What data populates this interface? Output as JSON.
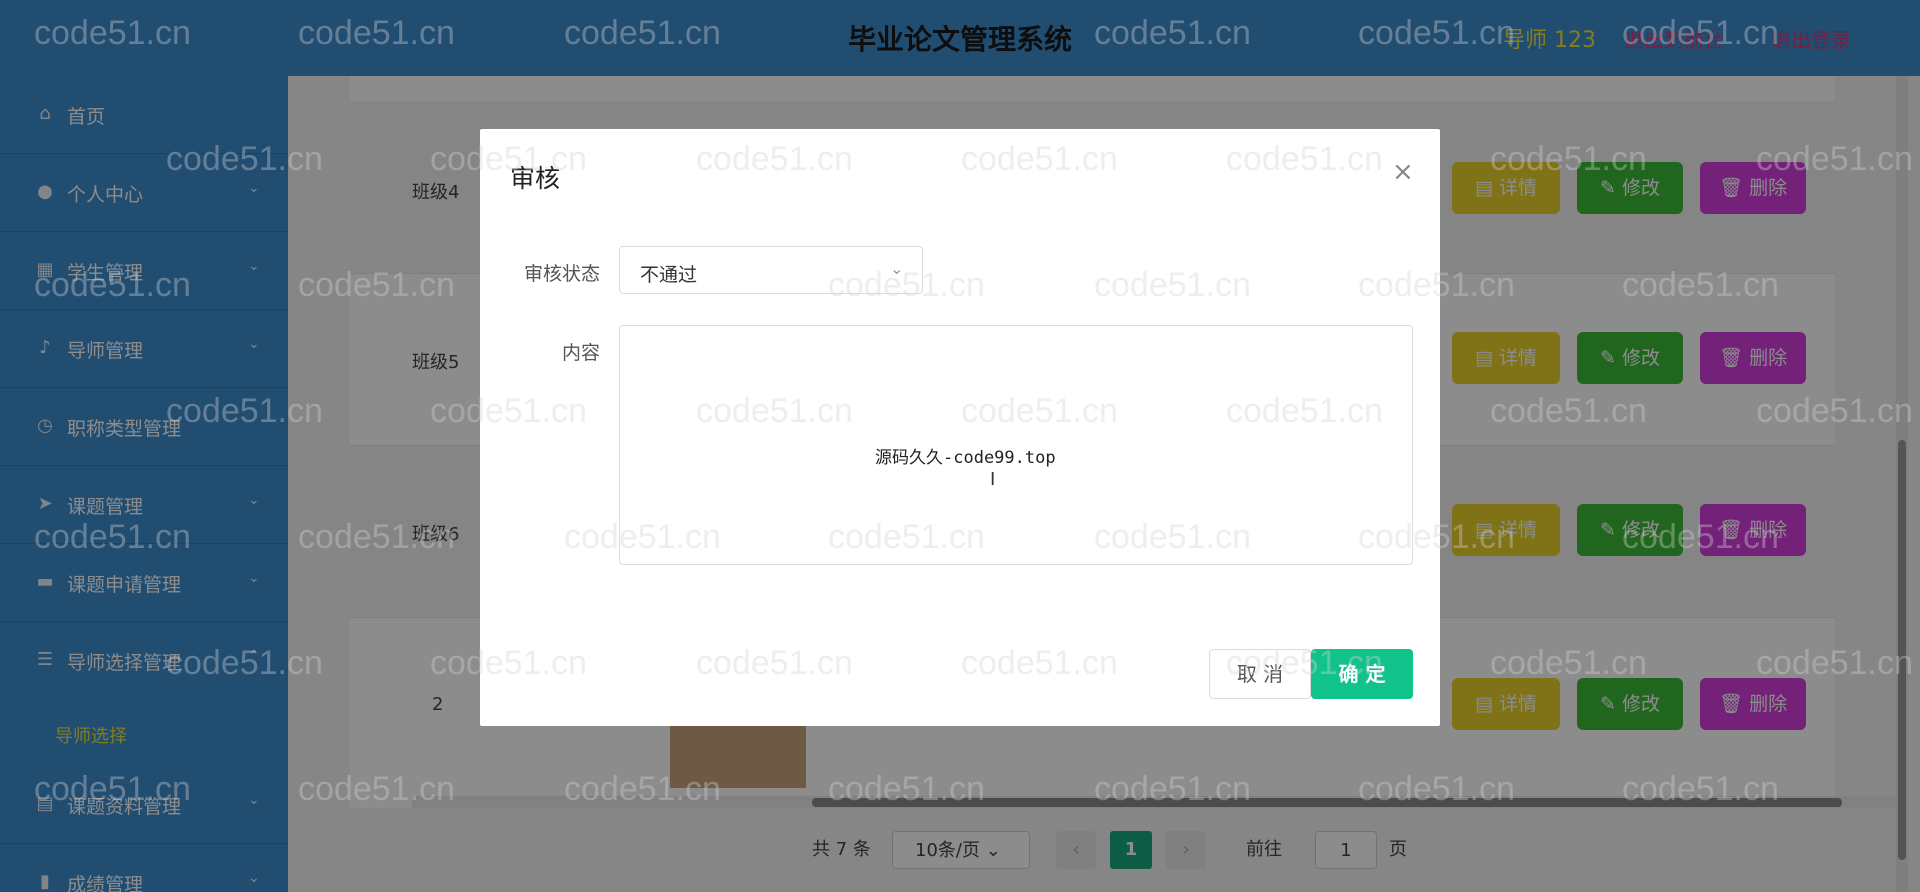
{
  "header": {
    "title": "毕业论文管理系统",
    "user": "导师 123",
    "link1": "退出到前台",
    "link2": "退出登录"
  },
  "sidebar": {
    "items": [
      {
        "label": "首页",
        "icon": "home-icon"
      },
      {
        "label": "个人中心",
        "icon": "user-icon"
      },
      {
        "label": "学生管理",
        "icon": "grid-icon"
      },
      {
        "label": "导师管理",
        "icon": "mic-icon"
      },
      {
        "label": "职称类型管理",
        "icon": "clock-icon"
      },
      {
        "label": "课题管理",
        "icon": "send-icon"
      },
      {
        "label": "课题申请管理",
        "icon": "folder-icon"
      },
      {
        "label": "导师选择管理",
        "icon": "list-icon"
      },
      {
        "label": "课题资料管理",
        "icon": "table-icon"
      },
      {
        "label": "成绩管理",
        "icon": "chart-icon"
      }
    ],
    "sub_item": "导师选择"
  },
  "table": {
    "rows": [
      {
        "class": "班级4"
      },
      {
        "class": "班级5"
      },
      {
        "class": "班级6"
      },
      {
        "class": "2"
      }
    ],
    "buttons": {
      "detail": "详情",
      "edit": "修改",
      "delete": "删除"
    }
  },
  "pager": {
    "total": "共 7 条",
    "size": "10条/页",
    "current": "1",
    "goto": "前往",
    "goto_value": "1",
    "page_suffix": "页"
  },
  "dialog": {
    "title": "审核",
    "status_label": "审核状态",
    "status_value": "不通过",
    "content_label": "内容",
    "content_value": "源码久久-code99.top",
    "cancel": "取 消",
    "ok": "确 定"
  },
  "watermark": "code51.cn",
  "colors": {
    "header_bg": "#3c8dce",
    "accent_ok": "#12c28b",
    "btn_detail": "#e9cf2b",
    "btn_edit": "#3dbb3a",
    "btn_delete": "#d13cdd"
  }
}
